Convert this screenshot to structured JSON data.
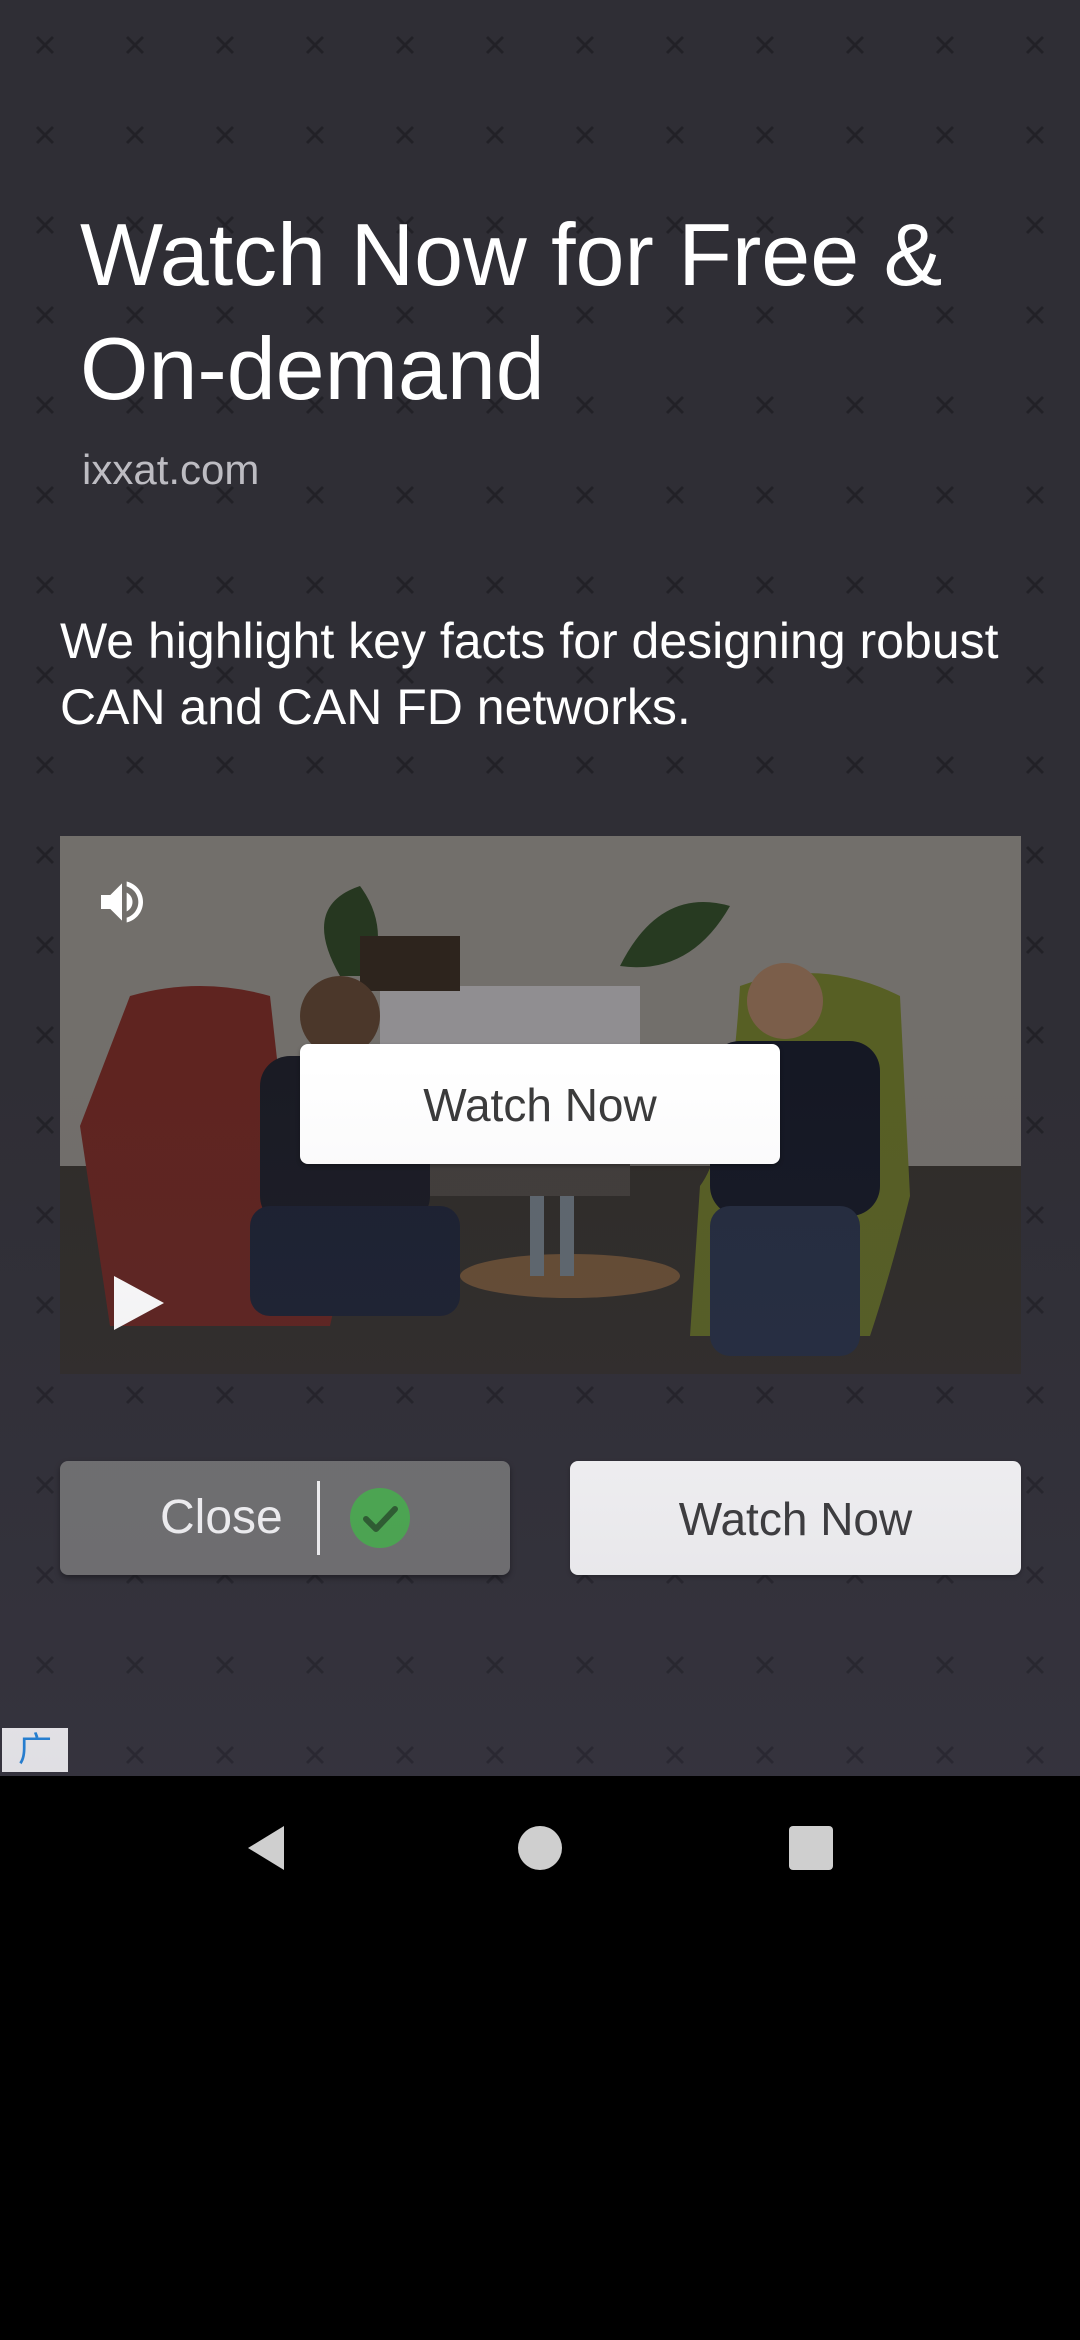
{
  "ad": {
    "headline": "Watch Now for Free & On-demand",
    "domain": "ixxat.com",
    "body": "We highlight key facts for designing robust CAN and CAN FD networks.",
    "video_cta_label": "Watch Now",
    "close_label": "Close",
    "bottom_cta_label": "Watch Now",
    "ad_badge": "广告"
  },
  "icons": {
    "sound": "speaker-icon",
    "play": "play-icon",
    "check": "check-circle-icon",
    "back": "back-icon",
    "home": "home-icon",
    "recents": "recents-icon"
  },
  "colors": {
    "background": "#2f2e35",
    "close_button": "#727272",
    "check": "#4caf50",
    "ad_badge_text": "#1e88e5"
  }
}
